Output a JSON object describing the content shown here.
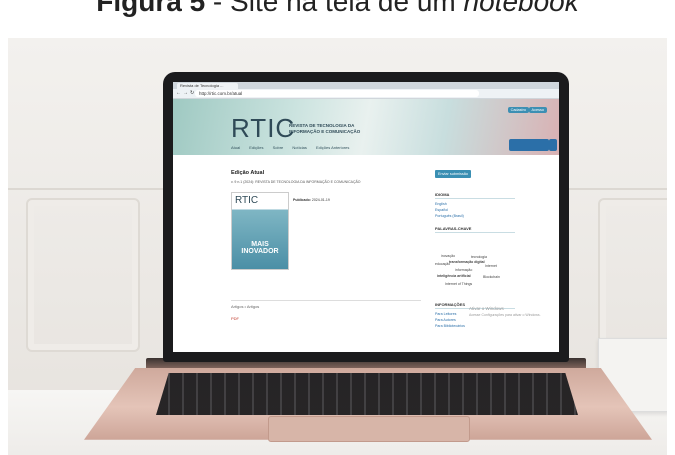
{
  "caption": {
    "label": "Figura 5",
    "sep": " - ",
    "text": "Site na tela de um",
    "italic": "notebook"
  },
  "browser": {
    "tab_title": "Revista de Tecnologia ...",
    "url": "http://rtic.com.br/atual",
    "nav_icons": [
      "back-icon",
      "forward-icon",
      "reload-icon",
      "home-icon"
    ]
  },
  "site": {
    "logo": "RTIC",
    "logo_text": "REVISTA DE TECNOLOGIA DA INFORMAÇÃO E COMUNICAÇÃO",
    "header_buttons": [
      "Cadastro",
      "Acesso"
    ],
    "menu": [
      "Atual",
      "Edições",
      "Sobre",
      "Notícias",
      "Edições Anteriores"
    ],
    "accent": "#3a8fb3"
  },
  "main": {
    "heading": "Edição Atual",
    "subheading": "v. 9 n.1 (2024): REVISTA DE TECNOLOGIA DA INFORMAÇÃO E COMUNICAÇÃO",
    "cover_logo": "RTIC",
    "cover_title": "MAIS INOVADOR",
    "published_label": "Publicado:",
    "published_date": "2024-01-19",
    "more_label": "Artigos • Artigos",
    "pdf_label": "PDF"
  },
  "sidebar": {
    "submit": "Enviar submissão",
    "idioma_title": "IDIOMA",
    "idioma_items": [
      "English",
      "Español",
      "Português (Brasil)"
    ],
    "keywords_title": "PALAVRAS-CHAVE",
    "keywords": [
      "inovação",
      "tecnologia",
      "educação",
      "transformação digital",
      "Internet",
      "informação",
      "inteligência artificial",
      "Blockchain",
      "Internet of Things"
    ],
    "info_title": "INFORMAÇÕES",
    "info_items": [
      "Para Leitores",
      "Para Autores",
      "Para Bibliotecários"
    ]
  },
  "overlay": {
    "line1": "Ativar o Windows",
    "line2": "Acesse Configurações para ativar o Windows."
  }
}
